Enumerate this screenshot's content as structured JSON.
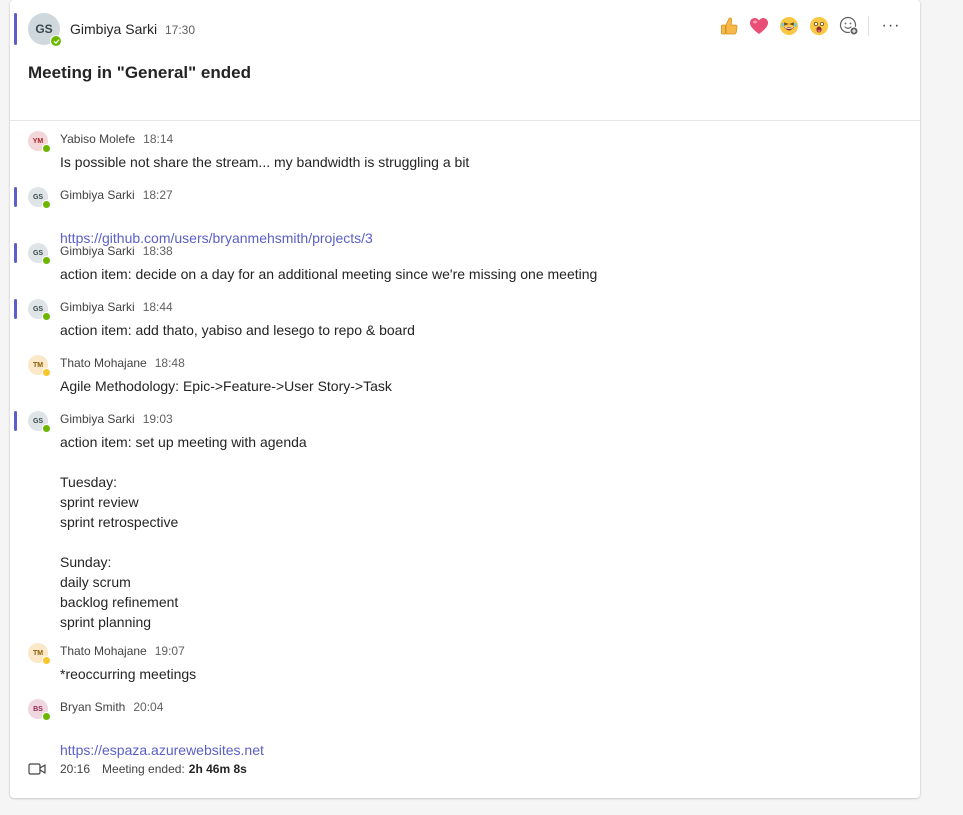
{
  "header": {
    "author": "Gimbiya Sarki",
    "initials": "GS",
    "time": "17:30",
    "title": "Meeting in \"General\" ended",
    "reactions": [
      "like-emoji",
      "heart-emoji",
      "laugh-emoji",
      "surprised-emoji",
      "add-reaction-icon"
    ],
    "more_label": "···"
  },
  "messages": [
    {
      "initials": "YM",
      "author": "Yabiso Molefe",
      "time": "18:14",
      "text": "Is possible not share the stream... my bandwidth is struggling a bit",
      "status": "available"
    },
    {
      "initials": "GS",
      "author": "Gimbiya Sarki",
      "time": "18:27",
      "text": "https://github.com/users/bryanmehsmith/projects/3",
      "is_link": true,
      "status": "available",
      "mention": true
    },
    {
      "initials": "GS",
      "author": "Gimbiya Sarki",
      "time": "18:38",
      "text": "action item: decide on a day for an additional meeting since we're missing one meeting",
      "status": "available",
      "mention": true
    },
    {
      "initials": "GS",
      "author": "Gimbiya Sarki",
      "time": "18:44",
      "text": "action item: add thato, yabiso and lesego to repo & board",
      "status": "available",
      "mention": true
    },
    {
      "initials": "TM",
      "author": "Thato Mohajane",
      "time": "18:48",
      "text": "Agile Methodology: Epic->Feature->User Story->Task",
      "status": "away"
    },
    {
      "initials": "GS",
      "author": "Gimbiya Sarki",
      "time": "19:03",
      "text": "action item: set up meeting with agenda\n\nTuesday:\nsprint review\nsprint retrospective\n\nSunday:\ndaily scrum\nbacklog refinement\nsprint planning",
      "status": "available",
      "mention": true
    },
    {
      "initials": "TM",
      "author": "Thato Mohajane",
      "time": "19:07",
      "text": "*reoccurring meetings",
      "status": "away"
    },
    {
      "initials": "BS",
      "author": "Bryan Smith",
      "time": "20:04",
      "text": "https://espaza.azurewebsites.net",
      "is_link": true,
      "status": "available"
    }
  ],
  "footer": {
    "time": "20:16",
    "label": "Meeting ended:",
    "duration": "2h 46m 8s"
  },
  "colors": {
    "accent": "#5b5fc7",
    "available": "#6bb700",
    "away": "#f8c62b"
  }
}
